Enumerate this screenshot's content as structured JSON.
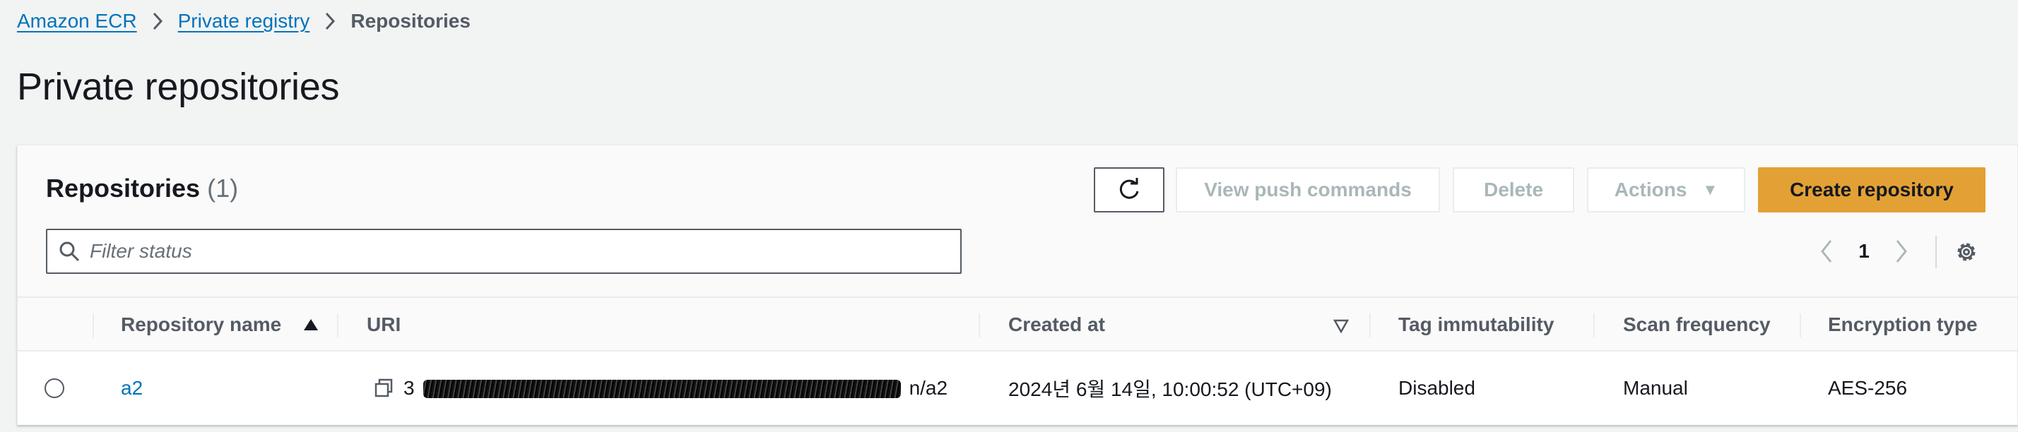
{
  "breadcrumb": {
    "items": [
      "Amazon ECR",
      "Private registry"
    ],
    "current": "Repositories"
  },
  "page": {
    "title": "Private repositories"
  },
  "table": {
    "title": "Repositories",
    "count": "(1)",
    "buttons": {
      "view_push": "View push commands",
      "delete": "Delete",
      "actions": "Actions",
      "create": "Create repository"
    },
    "filter_placeholder": "Filter status",
    "pagination": {
      "current_page": "1"
    },
    "columns": {
      "name": "Repository name",
      "uri": "URI",
      "created": "Created at",
      "tag": "Tag immutability",
      "scan": "Scan frequency",
      "encryption": "Encryption type"
    },
    "rows": [
      {
        "name": "a2",
        "uri_prefix": "3",
        "uri_suffix": "n/a2",
        "created": "2024년 6월 14일, 10:00:52 (UTC+09)",
        "tag": "Disabled",
        "scan": "Manual",
        "encryption": "AES-256"
      }
    ]
  },
  "colors": {
    "link": "#0073bb",
    "primary_button": "#e3a135",
    "background": "#f2f3f3"
  },
  "icons": [
    "chevron-right-icon",
    "refresh-icon",
    "caret-down-icon",
    "search-icon",
    "chevron-left-icon",
    "settings-icon",
    "sort-ascending-icon",
    "sort-descending-icon",
    "copy-icon"
  ]
}
